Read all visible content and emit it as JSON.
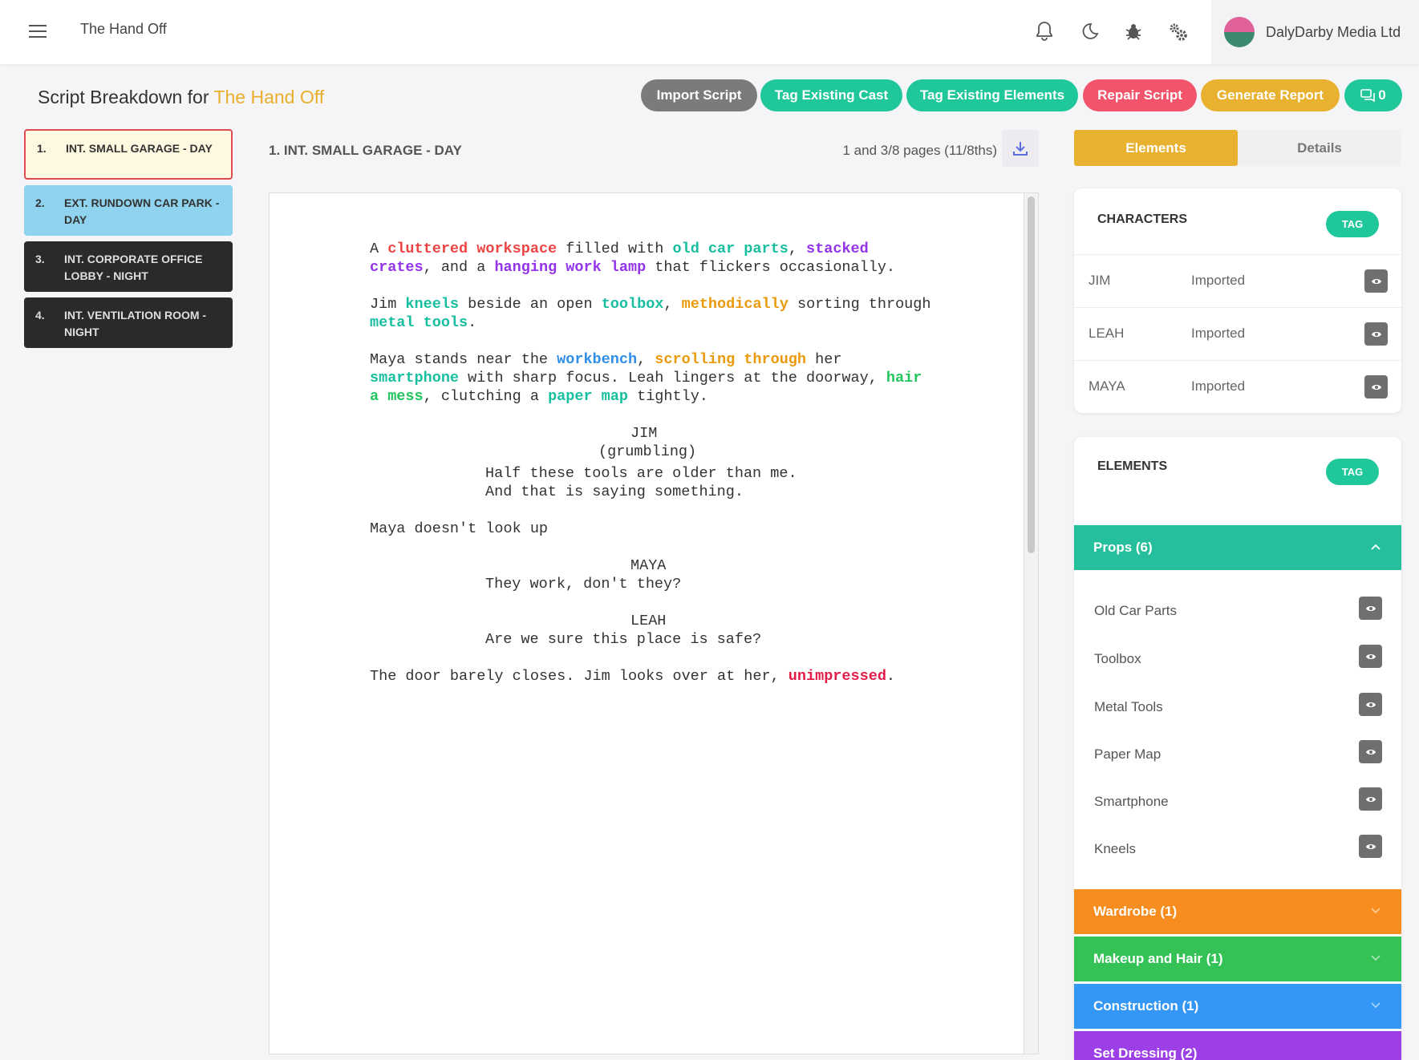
{
  "topbar": {
    "project_title": "The Hand Off",
    "account_name": "DalyDarby Media Ltd",
    "icons": [
      "bell-icon",
      "moon-icon",
      "bug-icon",
      "gears-icon"
    ]
  },
  "heading": {
    "prefix": "Script Breakdown for",
    "project": "The Hand Off"
  },
  "toolbar": {
    "import": "Import Script",
    "tag_cast": "Tag Existing Cast",
    "tag_elements": "Tag Existing Elements",
    "repair": "Repair Script",
    "report": "Generate Report",
    "comments_count": "0"
  },
  "colors": {
    "accent": "#e9ae2c",
    "import": "#7b7b7b",
    "green": "#1fc79a",
    "repair": "#f1546b",
    "report": "#e9b130",
    "tag_red": "#ef4444",
    "tag_teal": "#17bfa0",
    "tag_purple": "#9333ea",
    "tag_orange": "#ea9a0c",
    "tag_blue": "#2f8fe8",
    "tag_green": "#22c55e",
    "tag_red_strong": "#e11d48"
  },
  "scenes": [
    {
      "num": "1.",
      "title": "INT. SMALL GARAGE - DAY"
    },
    {
      "num": "2.",
      "title": "EXT. RUNDOWN CAR PARK - DAY"
    },
    {
      "num": "3.",
      "title": "INT. CORPORATE OFFICE LOBBY - NIGHT"
    },
    {
      "num": "4.",
      "title": "INT. VENTILATION ROOM - NIGHT"
    }
  ],
  "script": {
    "scene_heading": "1. INT. SMALL GARAGE - DAY",
    "page_count": "1 and 3/8 pages (11/8ths)",
    "p1": {
      "a": "A ",
      "b": "cluttered workspace",
      "c": " filled with ",
      "d": "old car parts",
      "e": ", ",
      "f": "stacked crates",
      "g": ", and a ",
      "h": "hanging work lamp",
      "i": " that flickers occasionally."
    },
    "p2": {
      "a": "Jim ",
      "b": "kneels",
      "c": " beside an open ",
      "d": "toolbox",
      "e": ", ",
      "f": "methodically",
      "g": " sorting through ",
      "h": "metal tools",
      "i": "."
    },
    "p3": {
      "a": "Maya stands near the ",
      "b": "workbench",
      "c": ", ",
      "d": "scrolling through",
      "e": " her ",
      "f": "smartphone",
      "g": " with sharp focus. Leah lingers at the doorway, ",
      "h": "hair a mess",
      "i": ", clutching a ",
      "j": "paper map",
      "k": " tightly."
    },
    "d1": {
      "cue": "JIM",
      "paren": "(grumbling)",
      "l1": "Half these tools are older than me.",
      "l2": "And that is saying something."
    },
    "p4": "Maya doesn't look up",
    "d2": {
      "cue": "MAYA",
      "l1": "They work, don't they?"
    },
    "d3": {
      "cue": "LEAH",
      "l1": "Are we sure this place is safe?"
    },
    "p5": {
      "a": "The door barely closes. Jim looks over at her, ",
      "b": "unimpressed",
      "c": "."
    }
  },
  "panel": {
    "tab_elements": "Elements",
    "tab_details": "Details",
    "characters_title": "CHARACTERS",
    "tag_label": "TAG",
    "characters": [
      {
        "name": "JIM",
        "status": "Imported"
      },
      {
        "name": "LEAH",
        "status": "Imported"
      },
      {
        "name": "MAYA",
        "status": "Imported"
      }
    ],
    "elements_title": "ELEMENTS",
    "categories": [
      {
        "label": "Props (6)",
        "color": "#26bf9e"
      },
      {
        "label": "Wardrobe (1)",
        "color": "#f78c1f"
      },
      {
        "label": "Makeup and Hair (1)",
        "color": "#34c256"
      },
      {
        "label": "Construction (1)",
        "color": "#3597f5"
      },
      {
        "label": "Set Dressing (2)",
        "color": "#9d3fe6"
      }
    ],
    "props": [
      "Old Car Parts",
      "Toolbox",
      "Metal Tools",
      "Paper Map",
      "Smartphone",
      "Kneels"
    ]
  }
}
